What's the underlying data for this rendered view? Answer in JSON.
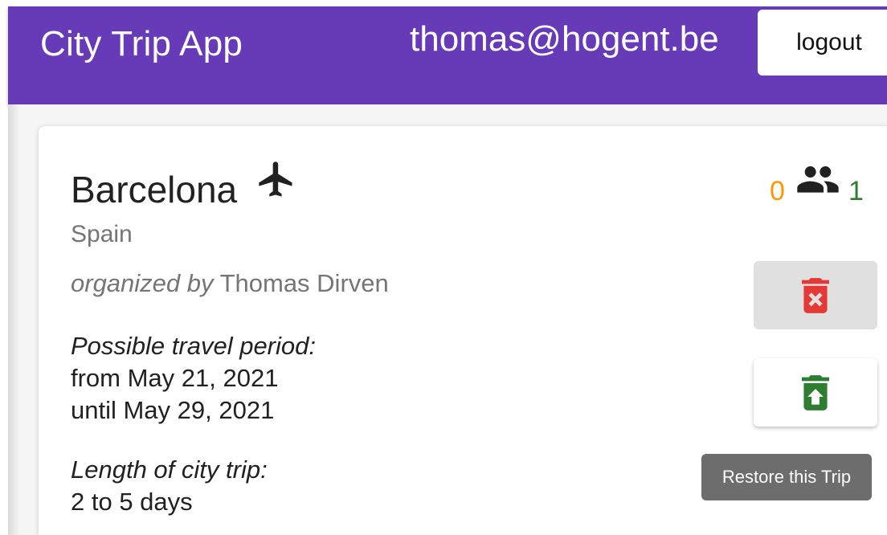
{
  "header": {
    "app_title": "City Trip App",
    "user_email": "thomas@hogent.be",
    "logout_label": "logout"
  },
  "trip": {
    "city": "Barcelona",
    "country": "Spain",
    "organized_by_prefix": "organized by",
    "organizer": "Thomas Dirven",
    "period_label": "Possible travel period:",
    "period_from": "from May 21, 2021",
    "period_until": "until May 29, 2021",
    "length_label": "Length of city trip:",
    "length_value": "2 to 5 days",
    "participants_pending": "0",
    "participants_confirmed": "1",
    "icons": {
      "transport": "airplane-icon",
      "participants": "people-icon",
      "delete": "delete-forever-icon",
      "restore": "restore-from-trash-icon"
    },
    "colors": {
      "pending": "#ff9800",
      "confirmed": "#2e7d32",
      "delete": "#e53935",
      "restore": "#2e7d32"
    }
  },
  "tooltip": {
    "restore_text": "Restore this Trip"
  },
  "colors": {
    "header_background": "#673ab7"
  }
}
